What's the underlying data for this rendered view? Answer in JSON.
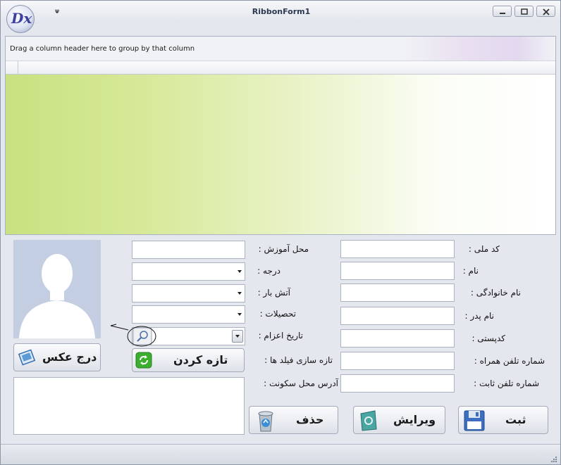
{
  "window": {
    "title": "RibbonForm1",
    "logo_text": "Dx"
  },
  "grid": {
    "group_panel_text": "Drag a column header here to group by that column"
  },
  "right_labels": {
    "national_code": "کد ملی :",
    "first_name": "نام :",
    "last_name": "نام خانوادگی :",
    "father_name": "نام پدر :",
    "postal_code": "کدپستی :",
    "mobile": "شماره تلفن همراه :",
    "phone": "شماره تلفن ثابت :"
  },
  "middle_labels": {
    "training_place": "محل آموزش :",
    "rank": "درجه :",
    "fire_station": "آتش بار :",
    "education": "تحصیلات :",
    "dispatch_date": "تاریخ اعزام :",
    "refresh_fields": "تازه سازی فیلد ها :",
    "address": "آدرس محل سکونت :"
  },
  "buttons": {
    "insert_photo": "درج عکس",
    "refresh": "تازه کردن",
    "delete": "حذف",
    "edit": "ویرایش",
    "save": "ثبت"
  },
  "colors": {
    "grid_gradient_start": "#c9e180",
    "accent": "#3a3fa0"
  }
}
